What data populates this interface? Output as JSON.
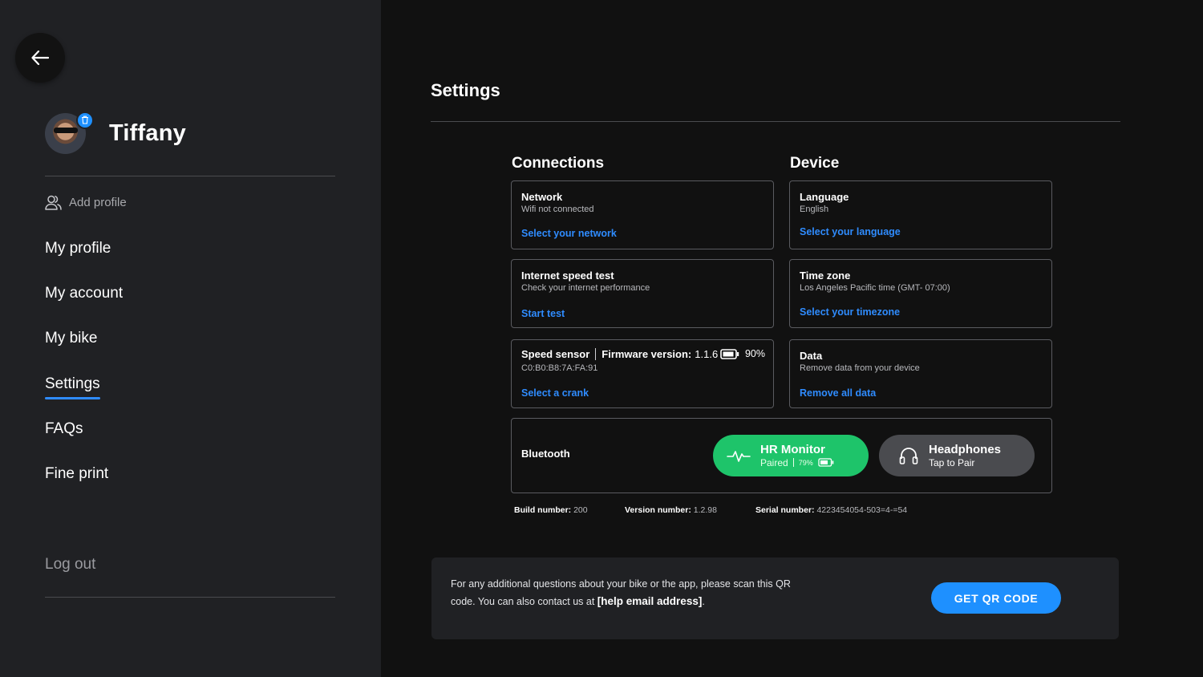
{
  "sidebar": {
    "profile_name": "Tiffany",
    "add_profile": "Add profile",
    "nav": {
      "my_profile": "My profile",
      "my_account": "My account",
      "my_bike": "My bike",
      "settings": "Settings",
      "faqs": "FAQs",
      "fine_print": "Fine print"
    },
    "active_item": "Settings",
    "logout": "Log out"
  },
  "main": {
    "title": "Settings",
    "connections": {
      "heading": "Connections",
      "network": {
        "title": "Network",
        "status": "Wifi not connected",
        "action": "Select your network"
      },
      "speed_test": {
        "title": "Internet speed test",
        "status": "Check your internet performance",
        "action": "Start test"
      },
      "speed_sensor": {
        "title": "Speed sensor",
        "firmware_label": "Firmware version:",
        "firmware_value": "1.1.6",
        "battery": "90%",
        "address": "C0:B0:B8:7A:FA:91",
        "action": "Select a crank"
      }
    },
    "device": {
      "heading": "Device",
      "language": {
        "title": "Language",
        "value": "English",
        "action": "Select your language"
      },
      "timezone": {
        "title": "Time zone",
        "value": "Los Angeles Pacific time (GMT- 07:00)",
        "action": "Select your timezone"
      },
      "data": {
        "title": "Data",
        "status": "Remove data from your device",
        "action": "Remove all data"
      }
    },
    "bluetooth": {
      "label": "Bluetooth",
      "hr_monitor": {
        "title": "HR Monitor",
        "status": "Paired",
        "battery": "79%"
      },
      "headphones": {
        "title": "Headphones",
        "status": "Tap to Pair"
      }
    },
    "meta": {
      "build_label": "Build number:",
      "build_value": "200",
      "version_label": "Version number:",
      "version_value": "1.2.98",
      "serial_label": "Serial number:",
      "serial_value": "4223454054-503=4-=54"
    },
    "help": {
      "text_1": "For any additional questions about your bike or the app, please scan this QR code. You can also contact us at ",
      "email": "[help email address]",
      "text_2": ".",
      "button": "GET QR CODE"
    }
  },
  "colors": {
    "accent": "#1e90ff",
    "link": "#2f8cff",
    "paired": "#1ec46a",
    "sidebar_bg": "#202124",
    "page_bg": "#111111"
  },
  "icons": {
    "back": "arrow-left-icon",
    "avatar_badge": "trash-icon",
    "add_profile": "users-icon",
    "battery": "battery-icon",
    "hr": "heartbeat-icon",
    "headphones": "headphones-icon"
  }
}
